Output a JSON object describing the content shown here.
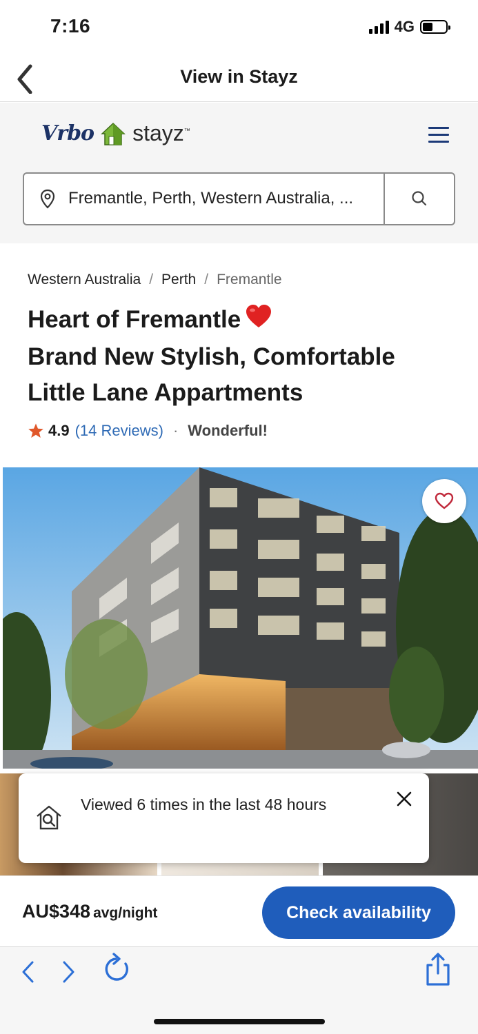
{
  "status_bar": {
    "time": "7:16",
    "network": "4G"
  },
  "nav": {
    "title": "View in Stayz"
  },
  "header": {
    "brand_vrbo": "Vrbo",
    "brand_stayz": "stayz",
    "brand_tm": "™"
  },
  "search": {
    "location_value": "Fremantle, Perth, Western Australia, ..."
  },
  "breadcrumb": {
    "items": [
      "Western Australia",
      "Perth",
      "Fremantle"
    ],
    "separator": "/"
  },
  "listing": {
    "title_line1": "Heart of Fremantle",
    "title_line2": "Brand New Stylish, Comfortable",
    "title_line3": "Little Lane Appartments",
    "rating": "4.9",
    "reviews": "(14 Reviews)",
    "rating_label": "Wonderful!"
  },
  "toast": {
    "message": "Viewed 6 times in the last 48 hours"
  },
  "booking": {
    "price": "AU$348",
    "price_unit": "avg/night",
    "cta": "Check availability"
  },
  "colors": {
    "accent": "#1f5dbb",
    "brand_navy": "#1c3266",
    "star": "#e0582b",
    "link": "#2e6ab5"
  }
}
